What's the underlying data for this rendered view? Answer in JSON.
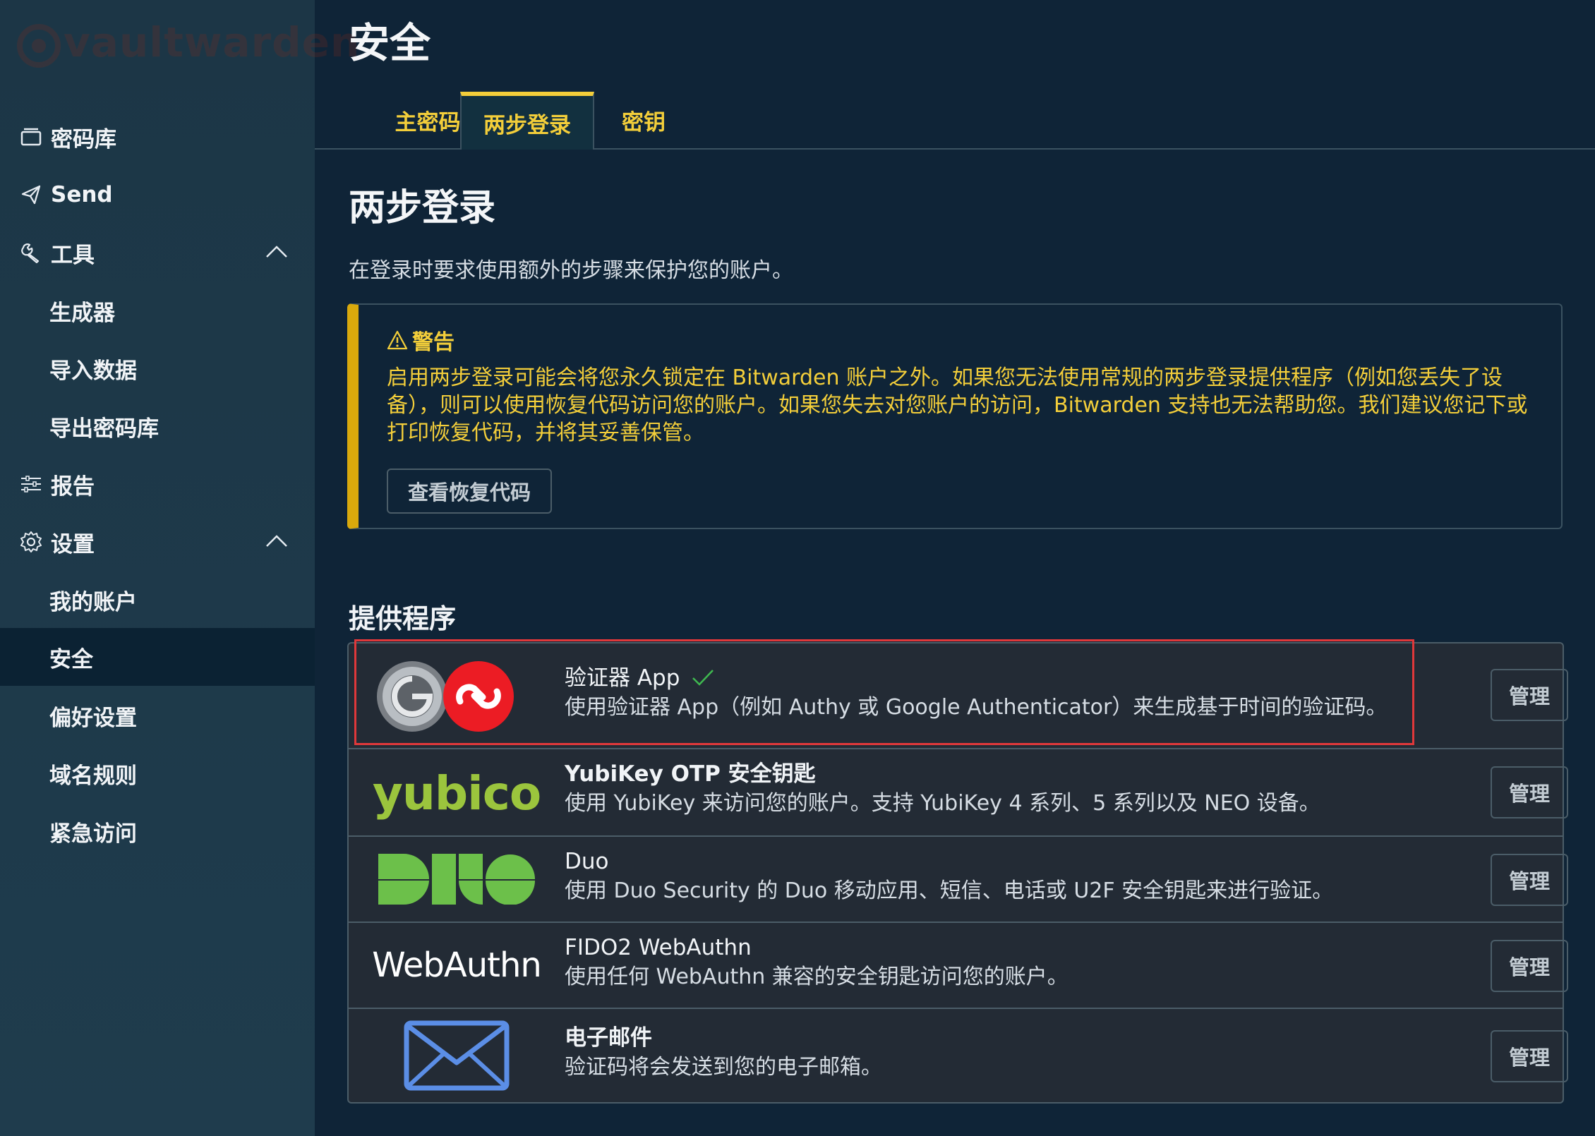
{
  "sidebar": {
    "logo_text": "vaultwarden",
    "items": [
      {
        "label": "密码库",
        "icon": "vault-icon"
      },
      {
        "label": "Send",
        "icon": "send-icon"
      },
      {
        "label": "工具",
        "icon": "wrench-icon"
      },
      {
        "label": "生成器"
      },
      {
        "label": "导入数据"
      },
      {
        "label": "导出密码库"
      },
      {
        "label": "报告",
        "icon": "sliders-icon"
      },
      {
        "label": "设置",
        "icon": "gear-icon"
      },
      {
        "label": "我的账户"
      },
      {
        "label": "安全"
      },
      {
        "label": "偏好设置"
      },
      {
        "label": "域名规则"
      },
      {
        "label": "紧急访问"
      }
    ]
  },
  "main": {
    "title": "安全",
    "tabs": [
      {
        "label": "主密码"
      },
      {
        "label": "两步登录"
      },
      {
        "label": "密钥"
      }
    ],
    "section_title": "两步登录",
    "section_desc": "在登录时要求使用额外的步骤来保护您的账户。",
    "warning": {
      "title": "警告",
      "body": "启用两步登录可能会将您永久锁定在 Bitwarden 账户之外。如果您无法使用常规的两步登录提供程序（例如您丢失了设备），则可以使用恢复代码访问您的账户。如果您失去对您账户的访问，Bitwarden 支持也无法帮助您。我们建议您记下或打印恢复代码，并将其妥善保管。",
      "button": "查看恢复代码"
    },
    "providers_title": "提供程序",
    "providers": [
      {
        "name": "验证器 App",
        "desc": "使用验证器 App（例如 Authy 或 Google Authenticator）来生成基于时间的验证码。",
        "manage": "管理"
      },
      {
        "name": "YubiKey OTP 安全钥匙",
        "desc": "使用 YubiKey 来访问您的账户。支持 YubiKey 4 系列、5 系列以及 NEO 设备。",
        "manage": "管理",
        "logo_text": "yubico"
      },
      {
        "name": "Duo",
        "desc": "使用 Duo Security 的 Duo 移动应用、短信、电话或 U2F 安全钥匙来进行验证。",
        "manage": "管理"
      },
      {
        "name": "FIDO2 WebAuthn",
        "desc": "使用任何 WebAuthn 兼容的安全钥匙访问您的账户。",
        "manage": "管理",
        "logo_text": "WebAuthn"
      },
      {
        "name": "电子邮件",
        "desc": "验证码将会发送到您的电子邮箱。",
        "manage": "管理"
      }
    ]
  },
  "colors": {
    "background": "#0f2437",
    "sidebar": "#1e3949",
    "accent": "#f3ce3a",
    "warning_border": "#d9a90c",
    "check": "#3fb950",
    "highlight": "#e0383a"
  }
}
